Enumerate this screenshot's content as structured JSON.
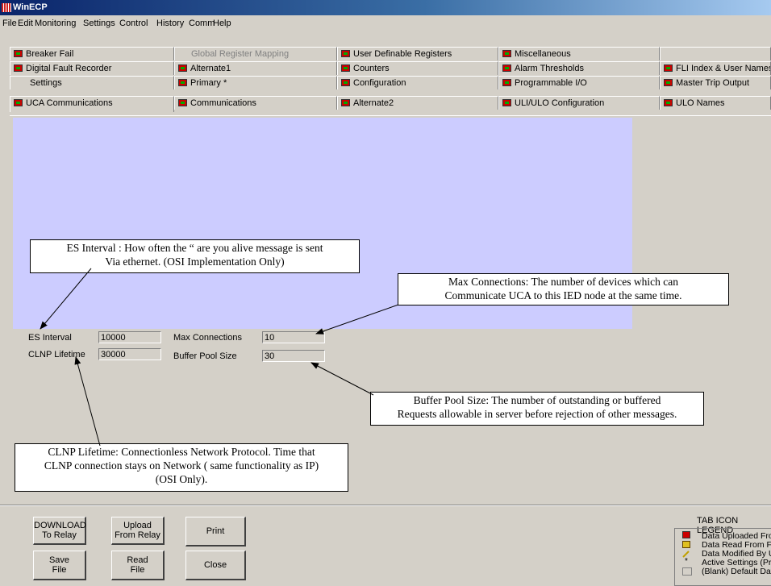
{
  "window": {
    "title": "WinECP"
  },
  "menu": [
    "File",
    "Edit",
    "Monitoring",
    "Settings",
    "Control",
    "History",
    "Comm",
    "Help"
  ],
  "tabs": {
    "row1": [
      "Breaker Fail",
      "Global Register Mapping",
      "User Definable Registers",
      "Miscellaneous",
      ""
    ],
    "row2": [
      "Digital Fault Recorder",
      "Alternate1",
      "Counters",
      "Alarm Thresholds",
      "FLI Index & User Names"
    ],
    "row3": [
      "Settings",
      "Primary *",
      "Configuration",
      "Programmable I/O",
      "Master Trip Output"
    ],
    "row4": [
      "UCA Communications",
      "Communications",
      "Alternate2",
      "ULI/ULO Configuration",
      "ULO Names"
    ]
  },
  "fields": {
    "es_interval": {
      "label": "ES Interval",
      "value": "10000"
    },
    "clnp_lifetime": {
      "label": "CLNP Lifetime",
      "value": "30000"
    },
    "max_connections": {
      "label": "Max Connections",
      "value": "10"
    },
    "buffer_pool_size": {
      "label": "Buffer Pool Size",
      "value": "30"
    }
  },
  "callouts": {
    "es_interval": [
      "ES Interval : How often the “ are you alive message is sent",
      "Via ethernet. (OSI Implementation Only)"
    ],
    "max_connections": [
      "Max Connections: The number of devices which can",
      "Communicate UCA to this IED node at the same time."
    ],
    "buffer_pool": [
      "Buffer Pool Size:  The number of outstanding or buffered",
      "Requests allowable in server before rejection of other messages."
    ],
    "clnp_lifetime": [
      "CLNP Lifetime: Connectionless Network Protocol.  Time that",
      "CLNP connection stays on Network ( same functionality as IP)",
      "(OSI Only)."
    ]
  },
  "buttons": {
    "download": [
      "DOWNLOAD",
      "To Relay"
    ],
    "upload": [
      "Upload",
      "From Relay"
    ],
    "print": "Print",
    "save": [
      "Save",
      "File"
    ],
    "read": [
      "Read",
      "File"
    ],
    "close": "Close"
  },
  "legend": {
    "title": "TAB ICON LEGEND",
    "items": [
      "Data Uploaded From Relay",
      "Data Read From File",
      "Data Modified By User",
      "Active Settings (Primary)",
      "(Blank) Default Data"
    ]
  }
}
